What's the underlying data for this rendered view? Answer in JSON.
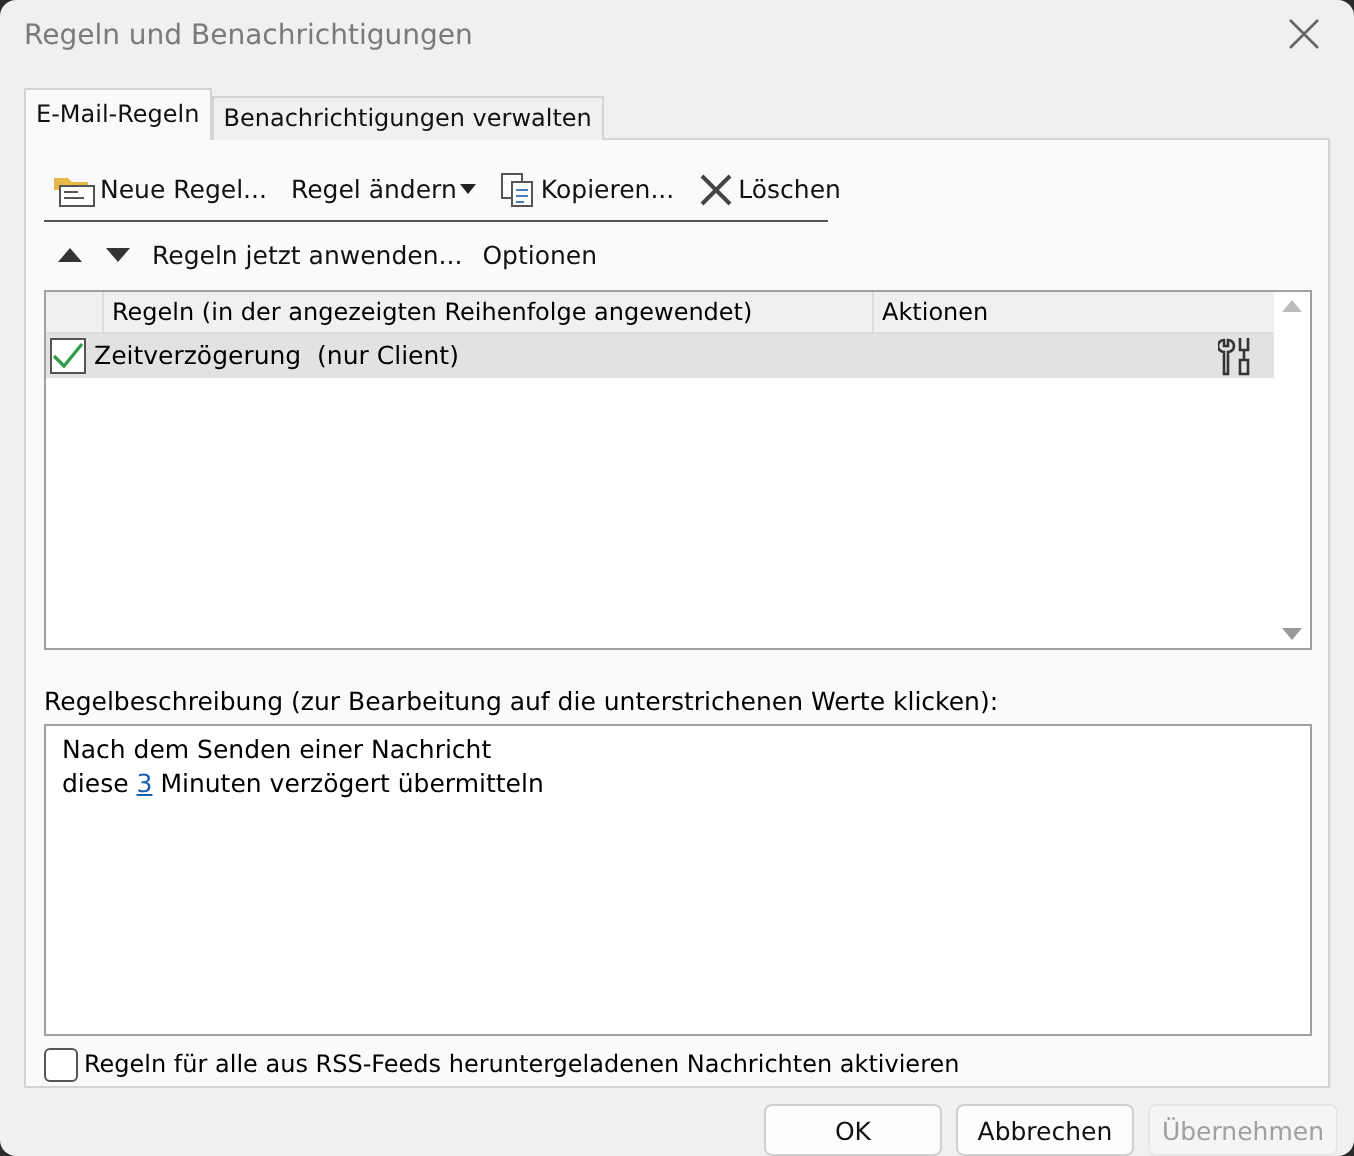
{
  "window": {
    "title": "Regeln und Benachrichtigungen"
  },
  "tabs": [
    {
      "label": "E-Mail-Regeln",
      "selected": true
    },
    {
      "label": "Benachrichtigungen verwalten",
      "selected": false
    }
  ],
  "toolbar": [
    {
      "label": "Neue Regel...",
      "kind": "new"
    },
    {
      "label": "Regel ändern",
      "kind": "dropdown"
    },
    {
      "label": "Kopieren...",
      "kind": "copy"
    },
    {
      "label": "Löschen",
      "kind": "delete"
    }
  ],
  "actions": [
    {
      "label": "Regeln jetzt anwenden..."
    },
    {
      "label": "Optionen"
    }
  ],
  "rules": {
    "columns": [
      "Regeln (in der angezeigten Reihenfolge angewendet)",
      "Aktionen"
    ],
    "rows": [
      {
        "name": "Zeitverzögerung  (nur Client)",
        "checked": true,
        "selected": true
      }
    ]
  },
  "description": {
    "label": "Regelbeschreibung (zur Bearbeitung auf die unterstrichenen Werte klicken):",
    "line_1": "Nach dem Senden einer Nachricht",
    "line_2": {
      "before": "diese ",
      "link": "3",
      "after": " Minuten verzögert übermitteln"
    }
  },
  "rss": {
    "label": "Regeln für alle aus RSS-Feeds heruntergeladenen Nachrichten aktivieren",
    "checked": false
  },
  "buttons": [
    {
      "label": "OK",
      "disabled": false
    },
    {
      "label": "Abbrechen",
      "disabled": false
    },
    {
      "label": "Übernehmen",
      "disabled": true
    }
  ]
}
